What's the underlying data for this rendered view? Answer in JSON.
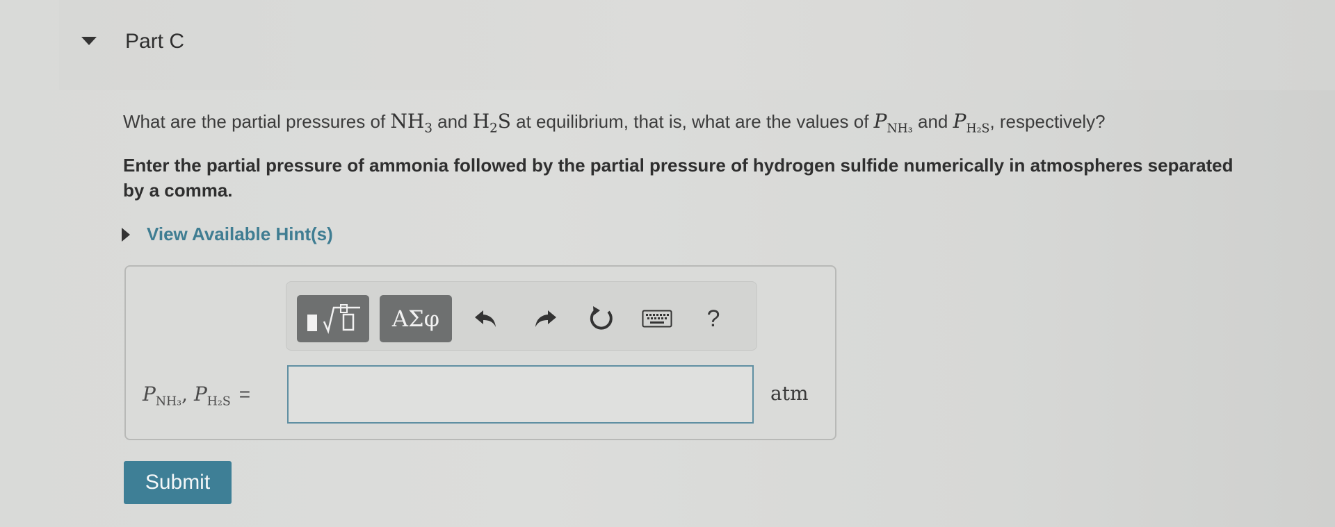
{
  "part": {
    "title": "Part C"
  },
  "question": {
    "text_1": "What are the partial pressures of ",
    "species_1": "NH",
    "species_1_sub": "3",
    "text_and_1": " and ",
    "species_2": "H",
    "species_2_sub": "2",
    "species_2_tail": "S",
    "text_2": " at equilibrium, that is, what are the values of ",
    "p1_symbol": "P",
    "p1_sub": "NH₃",
    "text_and_2": " and ",
    "p2_symbol": "P",
    "p2_sub": "H₂S",
    "text_3": ", respectively?"
  },
  "instruction": "Enter the partial pressure of ammonia followed by the partial pressure of hydrogen sulfide numerically in atmospheres separated by a comma.",
  "hint": {
    "label": "View Available Hint(s)"
  },
  "toolbar": {
    "greek_label": "ΑΣφ",
    "help_label": "?",
    "icons": [
      "templates-icon",
      "undo-icon",
      "redo-icon",
      "reset-icon",
      "keyboard-icon"
    ]
  },
  "answer": {
    "label_p1": "P",
    "label_p1_sub": "NH₃",
    "label_sep": ", ",
    "label_p2": "P",
    "label_p2_sub": "H₂S",
    "label_equals": "=",
    "value": "",
    "unit": "atm"
  },
  "submit": {
    "label": "Submit"
  },
  "colors": {
    "accent": "#3e7f96",
    "hint_link": "#3f7d92",
    "toolbar_button": "#6e7070"
  }
}
